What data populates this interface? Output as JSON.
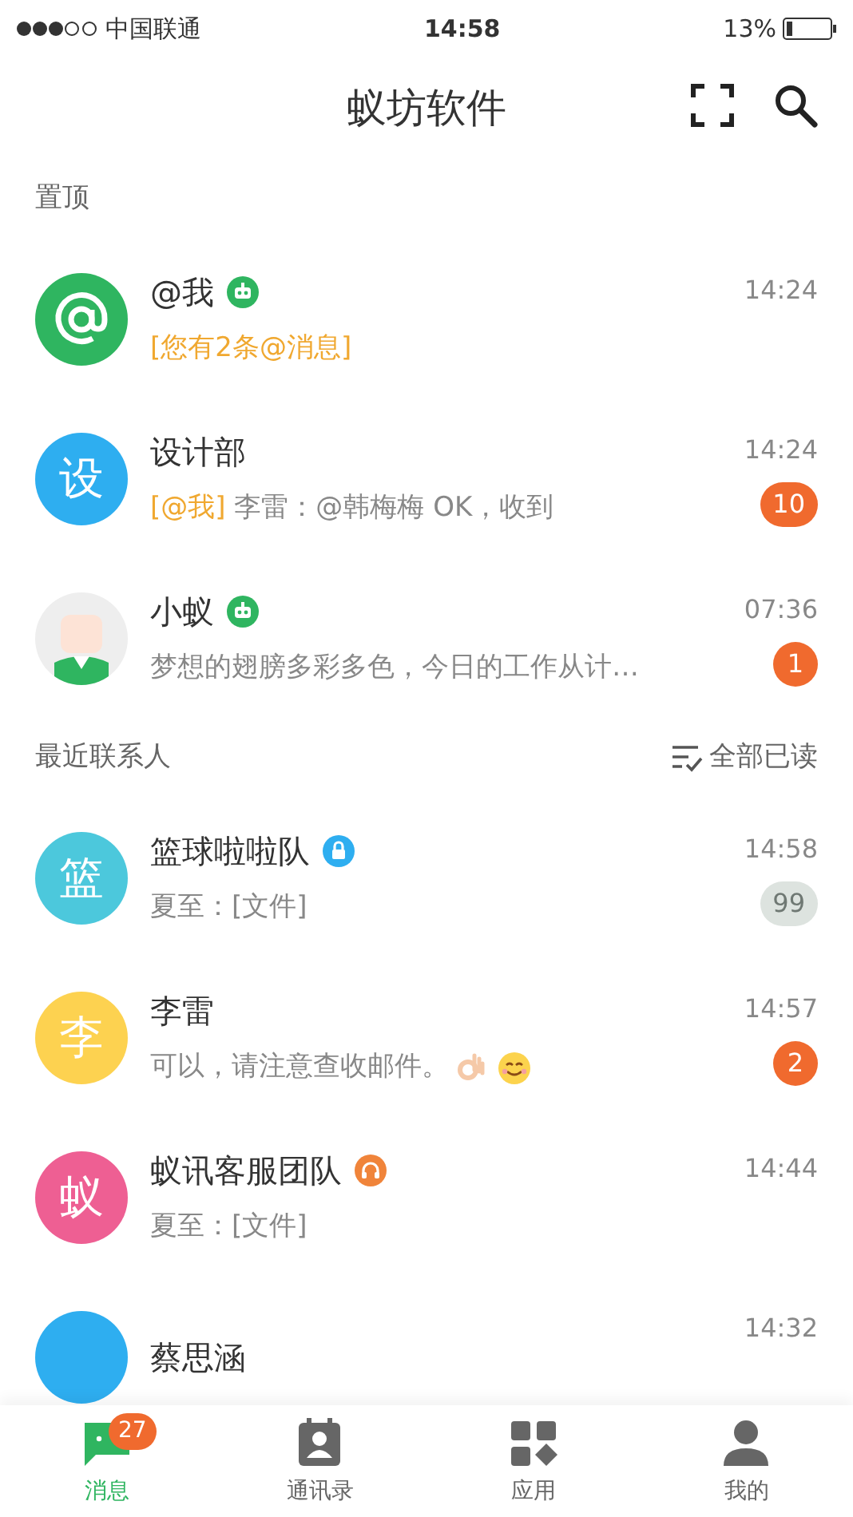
{
  "status_bar": {
    "carrier": "中国联通",
    "time": "14:58",
    "battery": "13%"
  },
  "header": {
    "title": "蚁坊软件"
  },
  "sections": [
    {
      "title": "置顶",
      "chats": [
        {
          "avatar": {
            "kind": "at",
            "color": "#2fb560"
          },
          "name": "@我",
          "name_badge": {
            "kind": "robot"
          },
          "time": "14:24",
          "preview_tag": "[您有2条@消息]"
        },
        {
          "avatar": {
            "kind": "text",
            "text": "设",
            "color": "#2eaef0"
          },
          "name": "设计部",
          "time": "14:24",
          "preview_tag": "[@我]",
          "preview": "李雷：@韩梅梅 OK，收到",
          "unread": {
            "count": "10",
            "muted": false
          }
        },
        {
          "avatar": {
            "kind": "cartoon",
            "color": "#eeeeee"
          },
          "name": "小蚁",
          "name_badge": {
            "kind": "robot"
          },
          "time": "07:36",
          "preview": "梦想的翅膀多彩多色，今日的工作从计…",
          "unread": {
            "count": "1",
            "muted": false
          }
        }
      ]
    },
    {
      "title": "最近联系人",
      "action": "全部已读",
      "chats": [
        {
          "avatar": {
            "kind": "text",
            "text": "篮",
            "color": "#4cc8dc"
          },
          "name": "篮球啦啦队",
          "name_badge": {
            "kind": "lock"
          },
          "time": "14:58",
          "preview": "夏至：[文件]",
          "unread": {
            "count": "99",
            "muted": true
          }
        },
        {
          "avatar": {
            "kind": "text",
            "text": "李",
            "color": "#fdd250"
          },
          "name": "李雷",
          "time": "14:57",
          "preview": "可以，请注意查收邮件。",
          "emojis": [
            {
              "kind": "ok"
            },
            {
              "kind": "smile"
            }
          ],
          "unread": {
            "count": "2",
            "muted": false
          }
        },
        {
          "avatar": {
            "kind": "text",
            "text": "蚁",
            "color": "#ee5f93"
          },
          "name": "蚁讯客服团队",
          "name_badge": {
            "kind": "headset"
          },
          "time": "14:44",
          "preview": "夏至：[文件]"
        },
        {
          "avatar": {
            "kind": "text",
            "color": "#2eaef0"
          },
          "name": "蔡思涵",
          "time": "14:32"
        }
      ]
    }
  ],
  "tab_bar": [
    {
      "label": "消息",
      "selected": true,
      "badge": "27"
    },
    {
      "label": "通讯录",
      "selected": false
    },
    {
      "label": "应用",
      "selected": false
    },
    {
      "label": "我的",
      "selected": false
    }
  ]
}
